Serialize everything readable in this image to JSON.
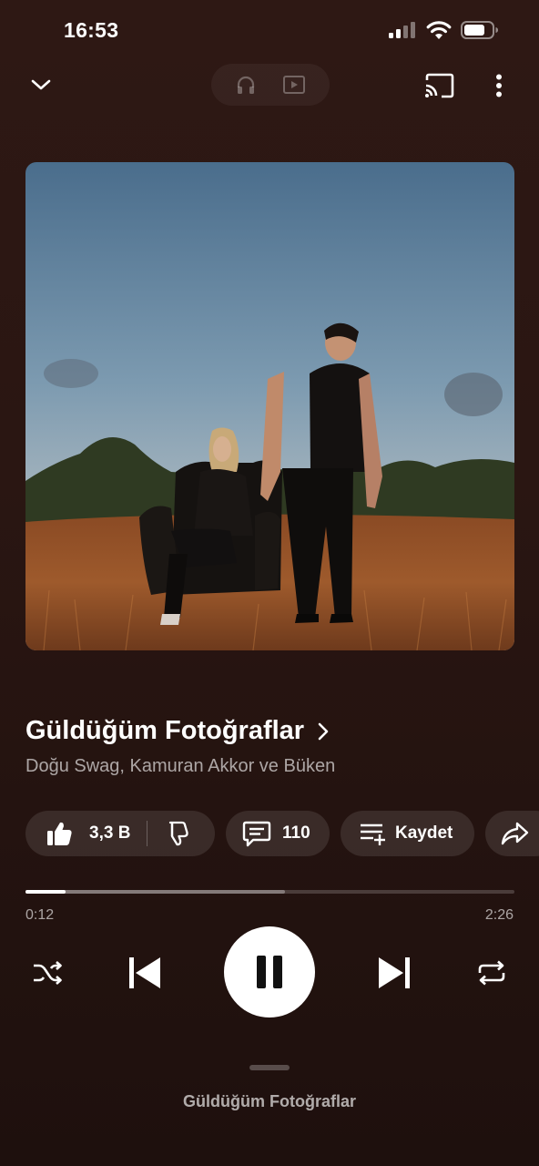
{
  "status_bar": {
    "time": "16:53",
    "icons": [
      "cellular-signal-icon",
      "wifi-icon",
      "battery-icon"
    ]
  },
  "top_bar": {
    "collapse_icon": "chevron-down-icon",
    "mode_toggle": [
      "headphones-icon",
      "video-icon"
    ],
    "cast_icon": "cast-icon",
    "more_icon": "more-vertical-icon"
  },
  "song": {
    "title": "Güldüğüm Fotoğraflar",
    "artists": "Doğu Swag, Kamuran Akkor ve Büken"
  },
  "actions": {
    "like_count": "3,3 B",
    "comment_count": "110",
    "save_label": "Kaydet"
  },
  "playback": {
    "current_time": "0:12",
    "total_time": "2:26",
    "progress": 0.082,
    "buffered": 0.53
  },
  "bottom": {
    "up_next_label": "Güldüğüm Fotoğraflar"
  },
  "colors": {
    "background": "#2a1612",
    "accent": "#ffffff"
  }
}
